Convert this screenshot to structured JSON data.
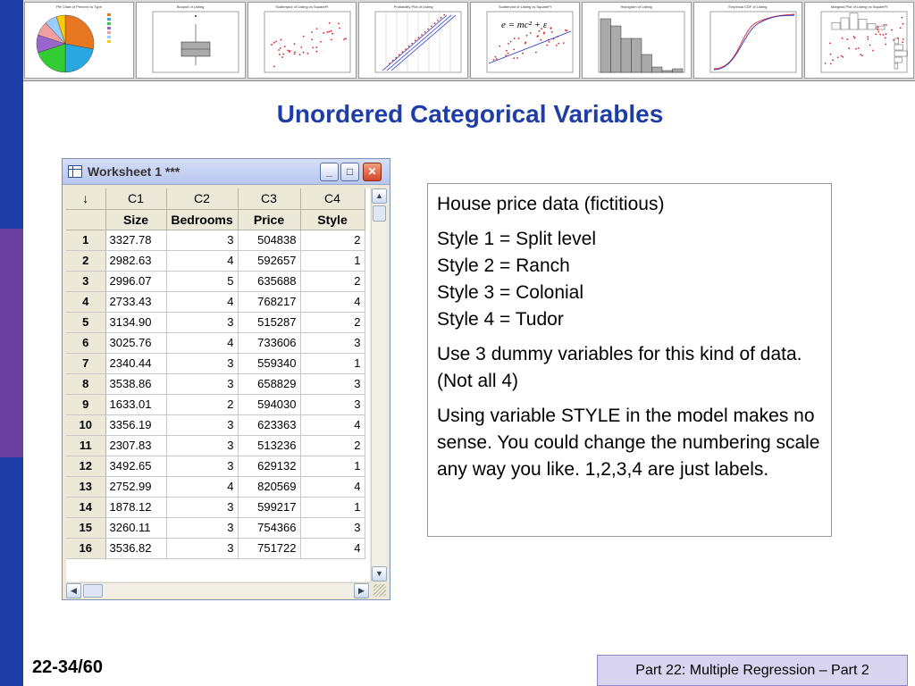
{
  "slide": {
    "title": "Unordered Categorical Variables",
    "page_number": "22-34/60",
    "footer": "Part 22: Multiple Regression – Part 2"
  },
  "thumbnails": [
    {
      "title": "Pie Chart of Percent vs Type",
      "kind": "pie"
    },
    {
      "title": "Boxplot of Listing",
      "kind": "box"
    },
    {
      "title": "Scatterplot of Listing vs SquareFt",
      "kind": "scatter"
    },
    {
      "title": "Probability Plot of Listing",
      "kind": "prob"
    },
    {
      "title": "Scatterplot of Listing vs SquareFt",
      "kind": "scatter-line",
      "formula": "e = mc² + ε"
    },
    {
      "title": "Histogram of Listing",
      "kind": "hist"
    },
    {
      "title": "Empirical CDF of Listing",
      "kind": "cdf"
    },
    {
      "title": "Marginal Plot of Listing vs SquareFt",
      "kind": "marginal"
    }
  ],
  "worksheet": {
    "title": "Worksheet 1 ***",
    "row_marker": "↓",
    "columns": [
      {
        "id": "C1",
        "name": "Size"
      },
      {
        "id": "C2",
        "name": "Bedrooms"
      },
      {
        "id": "C3",
        "name": "Price"
      },
      {
        "id": "C4",
        "name": "Style"
      }
    ],
    "rows": [
      [
        "1",
        "3327.78",
        "3",
        "504838",
        "2"
      ],
      [
        "2",
        "2982.63",
        "4",
        "592657",
        "1"
      ],
      [
        "3",
        "2996.07",
        "5",
        "635688",
        "2"
      ],
      [
        "4",
        "2733.43",
        "4",
        "768217",
        "4"
      ],
      [
        "5",
        "3134.90",
        "3",
        "515287",
        "2"
      ],
      [
        "6",
        "3025.76",
        "4",
        "733606",
        "3"
      ],
      [
        "7",
        "2340.44",
        "3",
        "559340",
        "1"
      ],
      [
        "8",
        "3538.86",
        "3",
        "658829",
        "3"
      ],
      [
        "9",
        "1633.01",
        "2",
        "594030",
        "3"
      ],
      [
        "10",
        "3356.19",
        "3",
        "623363",
        "4"
      ],
      [
        "11",
        "2307.83",
        "3",
        "513236",
        "2"
      ],
      [
        "12",
        "3492.65",
        "3",
        "629132",
        "1"
      ],
      [
        "13",
        "2752.99",
        "4",
        "820569",
        "4"
      ],
      [
        "14",
        "1878.12",
        "3",
        "599217",
        "1"
      ],
      [
        "15",
        "3260.11",
        "3",
        "754366",
        "3"
      ],
      [
        "16",
        "3536.82",
        "3",
        "751722",
        "4"
      ]
    ]
  },
  "textbox": {
    "heading": "House price data (fictitious)",
    "styles": [
      "Style 1 = Split level",
      "Style 2 = Ranch",
      "Style 3 = Colonial",
      "Style 4 = Tudor"
    ],
    "note1": "Use 3 dummy variables for this kind of data.  (Not all 4)",
    "note2": "Using variable STYLE in the model makes no sense. You could change the numbering scale any way you like. 1,2,3,4 are just labels."
  }
}
